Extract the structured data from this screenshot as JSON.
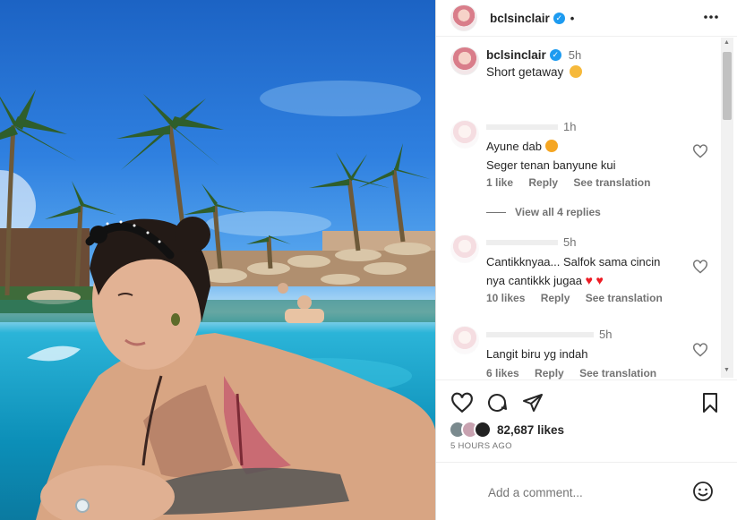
{
  "header": {
    "username": "bclsinclair",
    "dot": "•",
    "more_icon": "more-horizontal-icon"
  },
  "caption": {
    "username": "bclsinclair",
    "time": "5h",
    "text": "Short getaway"
  },
  "comments": [
    {
      "username": "",
      "time": "1h",
      "lines": [
        "Ayune dab",
        "Seger tenan banyune kui"
      ],
      "likes": "1 like",
      "reply": "Reply",
      "translate": "See translation",
      "view_replies": "View all 4 replies"
    },
    {
      "username": "",
      "time": "5h",
      "lines": [
        "Cantikknyaa... Salfok sama cincin",
        "nya cantikkk jugaa"
      ],
      "likes": "10 likes",
      "reply": "Reply",
      "translate": "See translation"
    },
    {
      "username": "",
      "time": "5h",
      "lines": [
        "Langit biru yg indah"
      ],
      "likes": "6 likes",
      "reply": "Reply",
      "translate": "See translation"
    }
  ],
  "actions": {
    "like_icon": "heart-icon",
    "comment_icon": "comment-icon",
    "share_icon": "send-icon",
    "save_icon": "bookmark-icon"
  },
  "likes": "82,687 likes",
  "timestamp": "5 HOURS AGO",
  "add_comment": {
    "placeholder": "Add a comment...",
    "emoji_icon": "smiley-icon"
  },
  "colors": {
    "verified": "#1d9bf0",
    "heart_red": "#ed1c24"
  }
}
